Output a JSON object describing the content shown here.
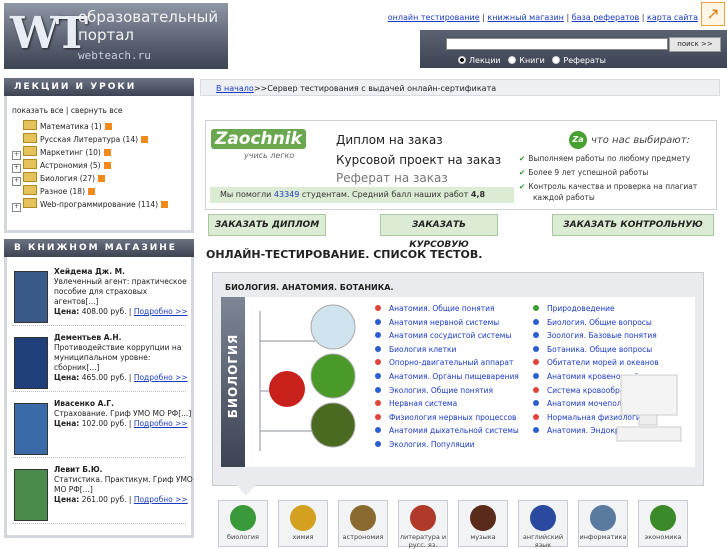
{
  "header": {
    "logo_mark": "WT",
    "logo_line1": "образовательный",
    "logo_line2": "портал",
    "logo_url": "webteach.ru",
    "topnav": [
      "онлайн тестирование",
      "книжный магазин",
      "база рефератов",
      "карта сайта"
    ],
    "search_button": "поиск >>",
    "radios": [
      "Лекции",
      "Книги",
      "Рефераты"
    ],
    "selected_radio": "Лекции"
  },
  "sidebar": {
    "lectures_title": "ЛЕКЦИИ И УРОКИ",
    "show_all": "показать все",
    "collapse_all": "свернуть все",
    "items": [
      {
        "label": "Математика (1)",
        "expandable": false
      },
      {
        "label": "Русская Литература (14)",
        "expandable": false
      },
      {
        "label": "Маркетинг (10)",
        "expandable": true
      },
      {
        "label": "Астрономия (5)",
        "expandable": true
      },
      {
        "label": "Биология (27)",
        "expandable": true
      },
      {
        "label": "Разное (18)",
        "expandable": false
      },
      {
        "label": "Web-программирование (114)",
        "expandable": true
      }
    ],
    "books_title": "В КНИЖНОМ МАГАЗИНЕ",
    "books": [
      {
        "author": "Хейдема Дж. М.",
        "desc": "Увлеченный агент: практическое пособие для страховых агентов[...]",
        "price_label": "Цена:",
        "price": "408.00 руб.",
        "more": "Подробно >>",
        "color": "#3a5a8a"
      },
      {
        "author": "Дементьев А.Н.",
        "desc": "Противодействие коррупции на муниципальном уровне: сборник[...]",
        "price_label": "Цена:",
        "price": "465.00 руб.",
        "more": "Подробно >>",
        "color": "#1f3f7a"
      },
      {
        "author": "Ивасенко А.Г.",
        "desc": "Страхование. Гриф УМО МО РФ[...]",
        "price_label": "Цена:",
        "price": "102.00 руб.",
        "more": "Подробно >>",
        "color": "#3a6aa8"
      },
      {
        "author": "Левит Б.Ю.",
        "desc": "Статистика. Практикум. Гриф УМО МО РФ[...]",
        "price_label": "Цена:",
        "price": "261.00 руб.",
        "more": "Подробно >>",
        "color": "#4a8a4a"
      }
    ]
  },
  "breadcrumb": {
    "home": "В начало",
    "current": ">>Сервер тестирования с выдачей онлайн-сертификата"
  },
  "ad": {
    "brand": "Zaochnik",
    "slogan": "учись легко",
    "lines": [
      "Диплом на заказ",
      "Курсовой проект на заказ",
      "Реферат на заказ"
    ],
    "strip_prefix": "Мы помогли",
    "strip_count": "43349",
    "strip_mid": "студентам. Средний балл наших работ",
    "strip_score": "4,8",
    "why_badge": "Za",
    "why_title": "что нас выбирают:",
    "why_list": [
      "Выполняем работы по любому предмету",
      "Более 9 лет успешной работы",
      "Контроль качества и проверка на плагиат",
      "каждой работы"
    ]
  },
  "order_buttons": [
    "ЗАКАЗАТЬ ДИПЛОМ",
    "ЗАКАЗАТЬ КУРСОВУЮ",
    "ЗАКАЗАТЬ КОНТРОЛЬНУЮ"
  ],
  "main_title": "ОНЛАЙН-ТЕСТИРОВАНИЕ. СПИСОК ТЕСТОВ.",
  "panel": {
    "title": "БИОЛОГИЯ. АНАТОМИЯ. БОТАНИКА.",
    "vertical": "БИОЛОГИЯ",
    "col1": [
      {
        "label": "Анатомия. Общие понятия",
        "color": "#e0443a"
      },
      {
        "label": "Анатомия нервной системы",
        "color": "#2b5fd0"
      },
      {
        "label": "Анатомия сосудистой системы",
        "color": "#2b5fd0"
      },
      {
        "label": "Биология клетки",
        "color": "#2b5fd0"
      },
      {
        "label": "Опорно-двигательный аппарат",
        "color": "#e0443a"
      },
      {
        "label": "Анатомия. Органы пищеварения",
        "color": "#2b5fd0"
      },
      {
        "label": "Экология. Общие понятия",
        "color": "#2b5fd0"
      },
      {
        "label": "Нервная система",
        "color": "#e0443a"
      },
      {
        "label": "Физиология нервных процессов",
        "color": "#e0443a"
      },
      {
        "label": "Анатомия дыхательной системы",
        "color": "#2b5fd0"
      },
      {
        "label": "Экология. Популяции",
        "color": "#2b5fd0"
      }
    ],
    "col2": [
      {
        "label": "Природоведение",
        "color": "#3aa032"
      },
      {
        "label": "Биология. Общие вопросы",
        "color": "#2b5fd0"
      },
      {
        "label": "Зоология. Базовые понятия",
        "color": "#2b5fd0"
      },
      {
        "label": "Ботаника. Общие вопросы",
        "color": "#2b5fd0"
      },
      {
        "label": "Обитатели морей и океанов",
        "color": "#e0443a"
      },
      {
        "label": "Анатомия кровеносной системы",
        "color": "#2b5fd0"
      },
      {
        "label": "Система кровообращения",
        "color": "#e0443a"
      },
      {
        "label": "Анатомия мочеполовой системы",
        "color": "#2b5fd0"
      },
      {
        "label": "Нормальная физиология",
        "color": "#e0443a"
      },
      {
        "label": "Анатомия. Эндокринная система",
        "color": "#2b5fd0"
      }
    ]
  },
  "category_tabs": [
    {
      "label": "биология",
      "icon": "tree-icon",
      "color": "#3a9a3a"
    },
    {
      "label": "химия",
      "icon": "flask-icon",
      "color": "#d4a020"
    },
    {
      "label": "астрономия",
      "icon": "planet-icon",
      "color": "#8a6a30"
    },
    {
      "label": "литература и русс. яз.",
      "icon": "books-icon",
      "color": "#b03a2a"
    },
    {
      "label": "музыка",
      "icon": "piano-icon",
      "color": "#5a2a1a"
    },
    {
      "label": "английский язык",
      "icon": "flag-icon",
      "color": "#2a4aa0"
    },
    {
      "label": "информатика",
      "icon": "computer-icon",
      "color": "#5a7aa0"
    },
    {
      "label": "экономика",
      "icon": "dollar-icon",
      "color": "#3a8a2a"
    }
  ]
}
